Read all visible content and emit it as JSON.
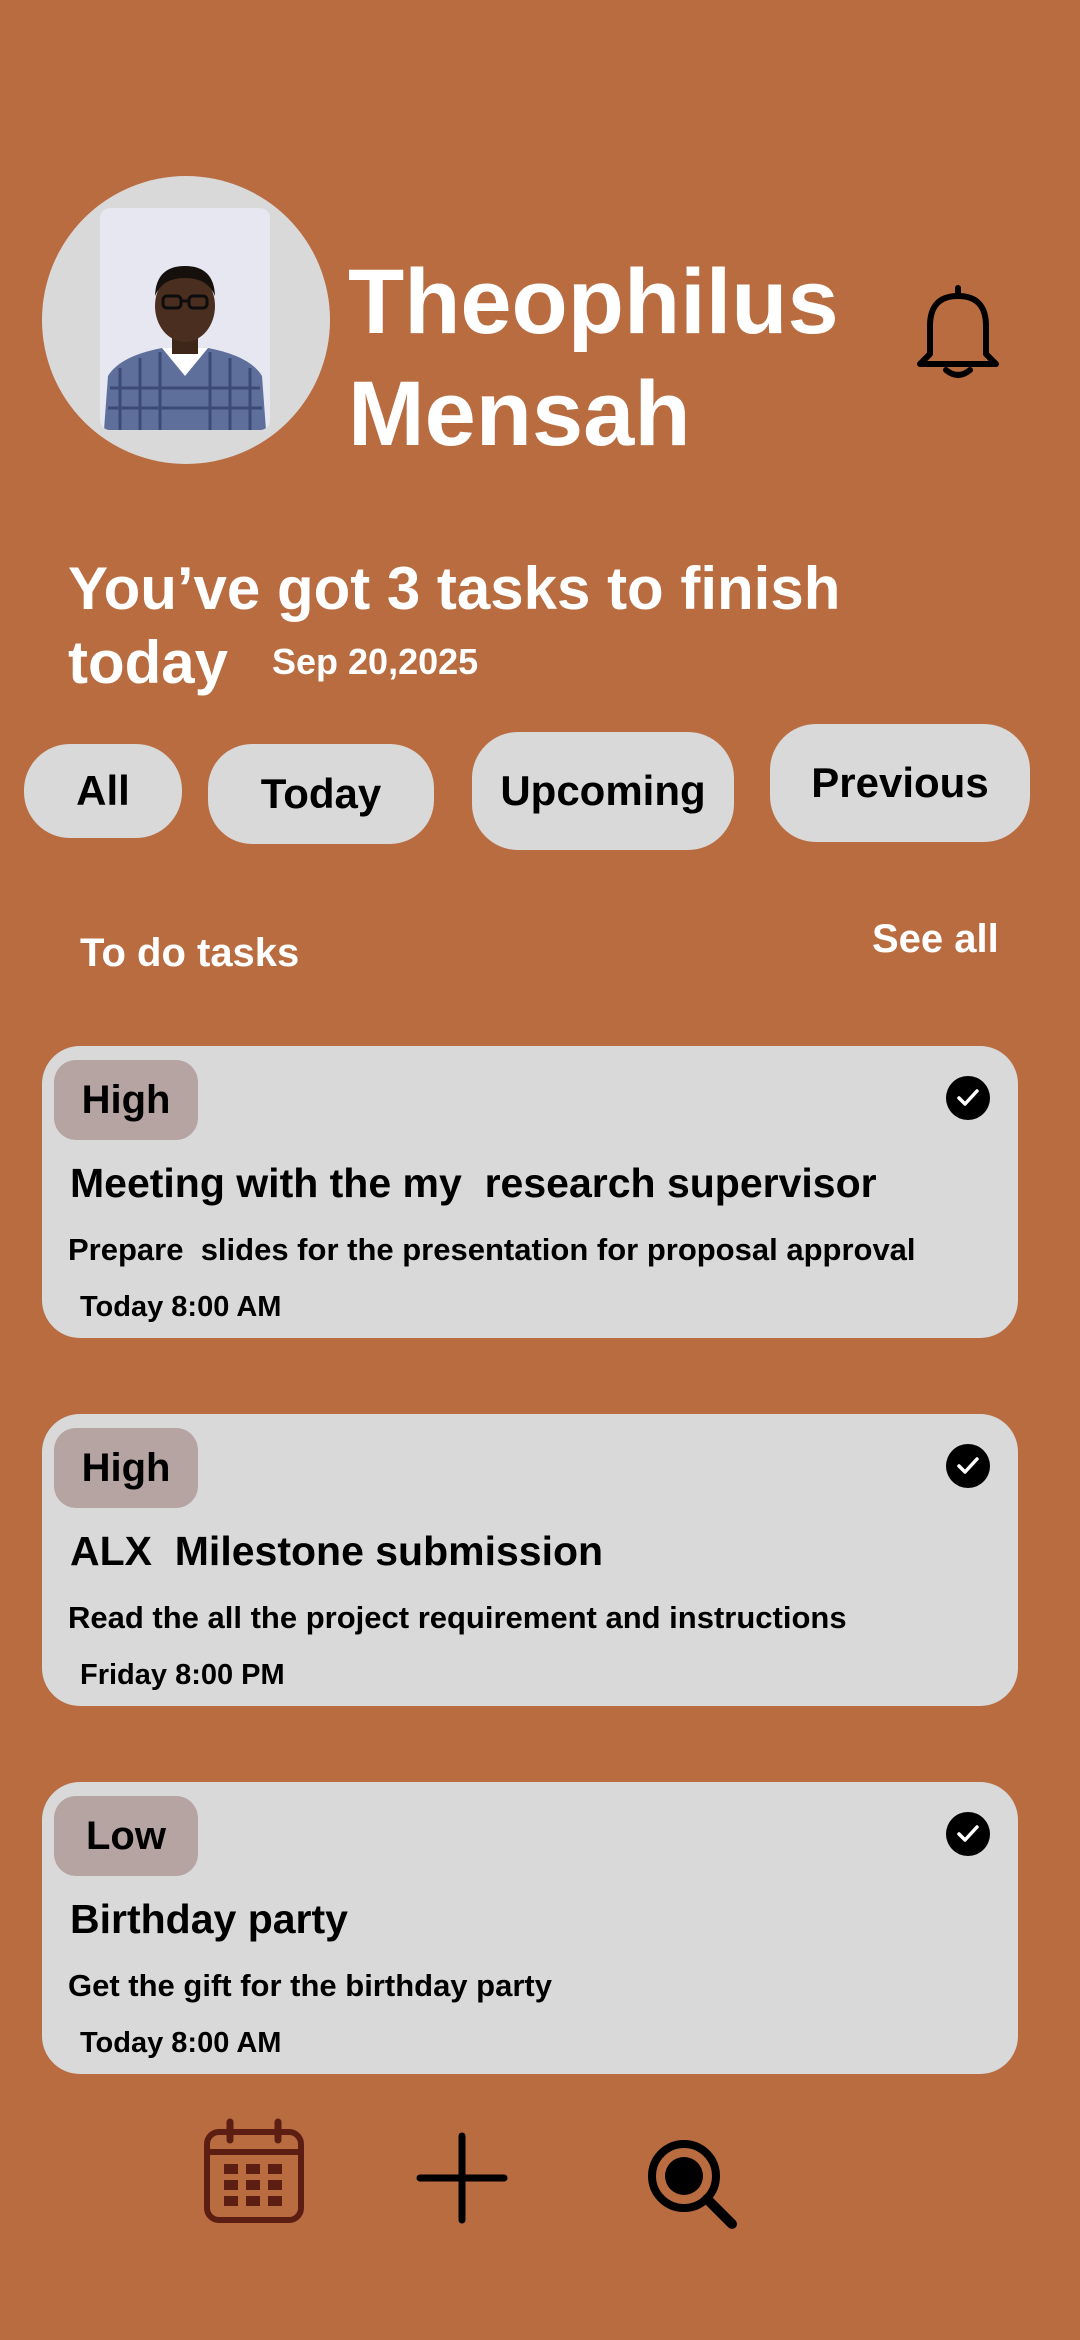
{
  "profile": {
    "name": "Theophilus\n Mensah",
    "avatar_icon": "user-photo",
    "notification_icon": "bell-icon"
  },
  "greeting": {
    "headline": "You’ve got 3 tasks to finish today",
    "date": "Sep 20,2025"
  },
  "filters": [
    {
      "label": "All"
    },
    {
      "label": "Today"
    },
    {
      "label": "Upcoming"
    },
    {
      "label": "Previous"
    }
  ],
  "section": {
    "title": "To do tasks",
    "see_all": "See all"
  },
  "tasks": [
    {
      "priority": "High",
      "title": "Meeting with the my  research supervisor",
      "description": "Prepare  slides for the presentation for proposal approval",
      "time": "Today 8:00 AM",
      "completed_icon": "check-circle-icon"
    },
    {
      "priority": "High",
      "title": "ALX  Milestone submission",
      "description": "Read the all the project requirement and instructions",
      "time": "Friday 8:00 PM",
      "completed_icon": "check-circle-icon"
    },
    {
      "priority": "Low",
      "title": "Birthday party",
      "description": "Get the gift for the birthday party",
      "time": "Today 8:00 AM",
      "completed_icon": "check-circle-icon"
    }
  ],
  "bottom_nav": [
    {
      "icon": "calendar-icon"
    },
    {
      "icon": "plus-icon"
    },
    {
      "icon": "search-icon"
    }
  ],
  "colors": {
    "background": "#B96C40",
    "card": "#D9D9D9",
    "priority_badge": "#B6A4A2",
    "calendar_icon": "#5C1E12"
  }
}
